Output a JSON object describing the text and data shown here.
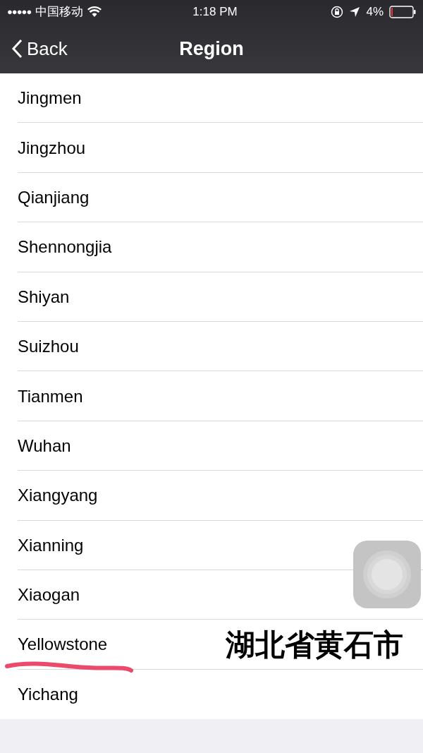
{
  "status_bar": {
    "signal_dots": "●●●●●",
    "carrier": "中国移动",
    "time": "1:18 PM",
    "battery": "4%"
  },
  "nav_bar": {
    "back": "Back",
    "title": "Region"
  },
  "regions": [
    {
      "name": "Jingmen"
    },
    {
      "name": "Jingzhou"
    },
    {
      "name": "Qianjiang"
    },
    {
      "name": "Shennongjia"
    },
    {
      "name": "Shiyan"
    },
    {
      "name": "Suizhou"
    },
    {
      "name": "Tianmen"
    },
    {
      "name": "Wuhan"
    },
    {
      "name": "Xiangyang"
    },
    {
      "name": "Xianning"
    },
    {
      "name": "Xiaogan"
    },
    {
      "name": "Yellowstone",
      "annotation": "湖北省黄石市",
      "underlined": true
    },
    {
      "name": "Yichang"
    }
  ]
}
